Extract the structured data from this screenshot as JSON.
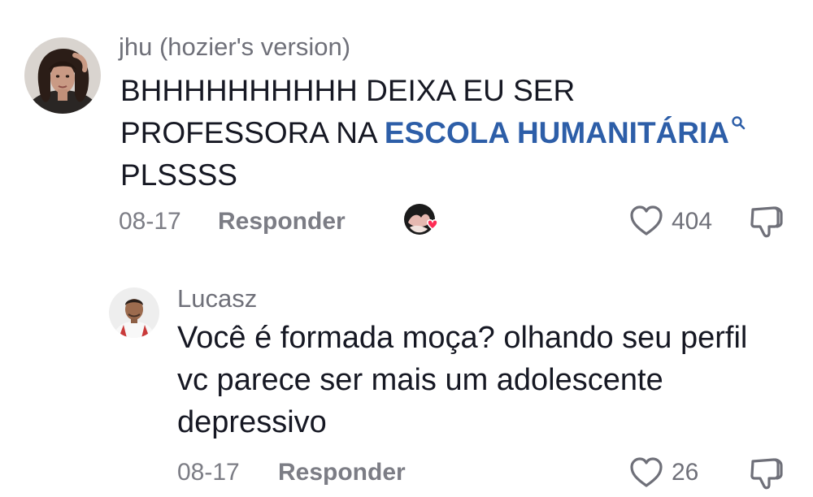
{
  "comments": [
    {
      "username": "jhu (hozier's version)",
      "text_line1": "BHHHHHHHHHH DEIXA EU SER",
      "text_line2_prefix": "PROFESSORA NA ",
      "hashtag_link": "ESCOLA HUMANITÁRIA",
      "text_line3": "PLSSSS",
      "date": "08-17",
      "reply_label": "Responder",
      "like_count": "404",
      "liked_by_creator": true,
      "link_color": "#2d5ea8"
    },
    {
      "username": "Lucasz",
      "text_line1": "Você é formada moça? olhando seu perfil",
      "text_line2": "vc parece ser mais um adolescente",
      "text_line3": "depressivo",
      "date": "08-17",
      "reply_label": "Responder",
      "like_count": "26"
    }
  ],
  "icons": {
    "like": "heart-outline-icon",
    "dislike": "thumbs-down-outline-icon",
    "creator_like": "creator-liked-heart-icon",
    "hashtag_search": "search-icon"
  },
  "colors": {
    "text": "#161823",
    "secondary": "#7c7d85",
    "hashtag": "#2d5ea8",
    "creator_heart": "#fe2c55"
  }
}
